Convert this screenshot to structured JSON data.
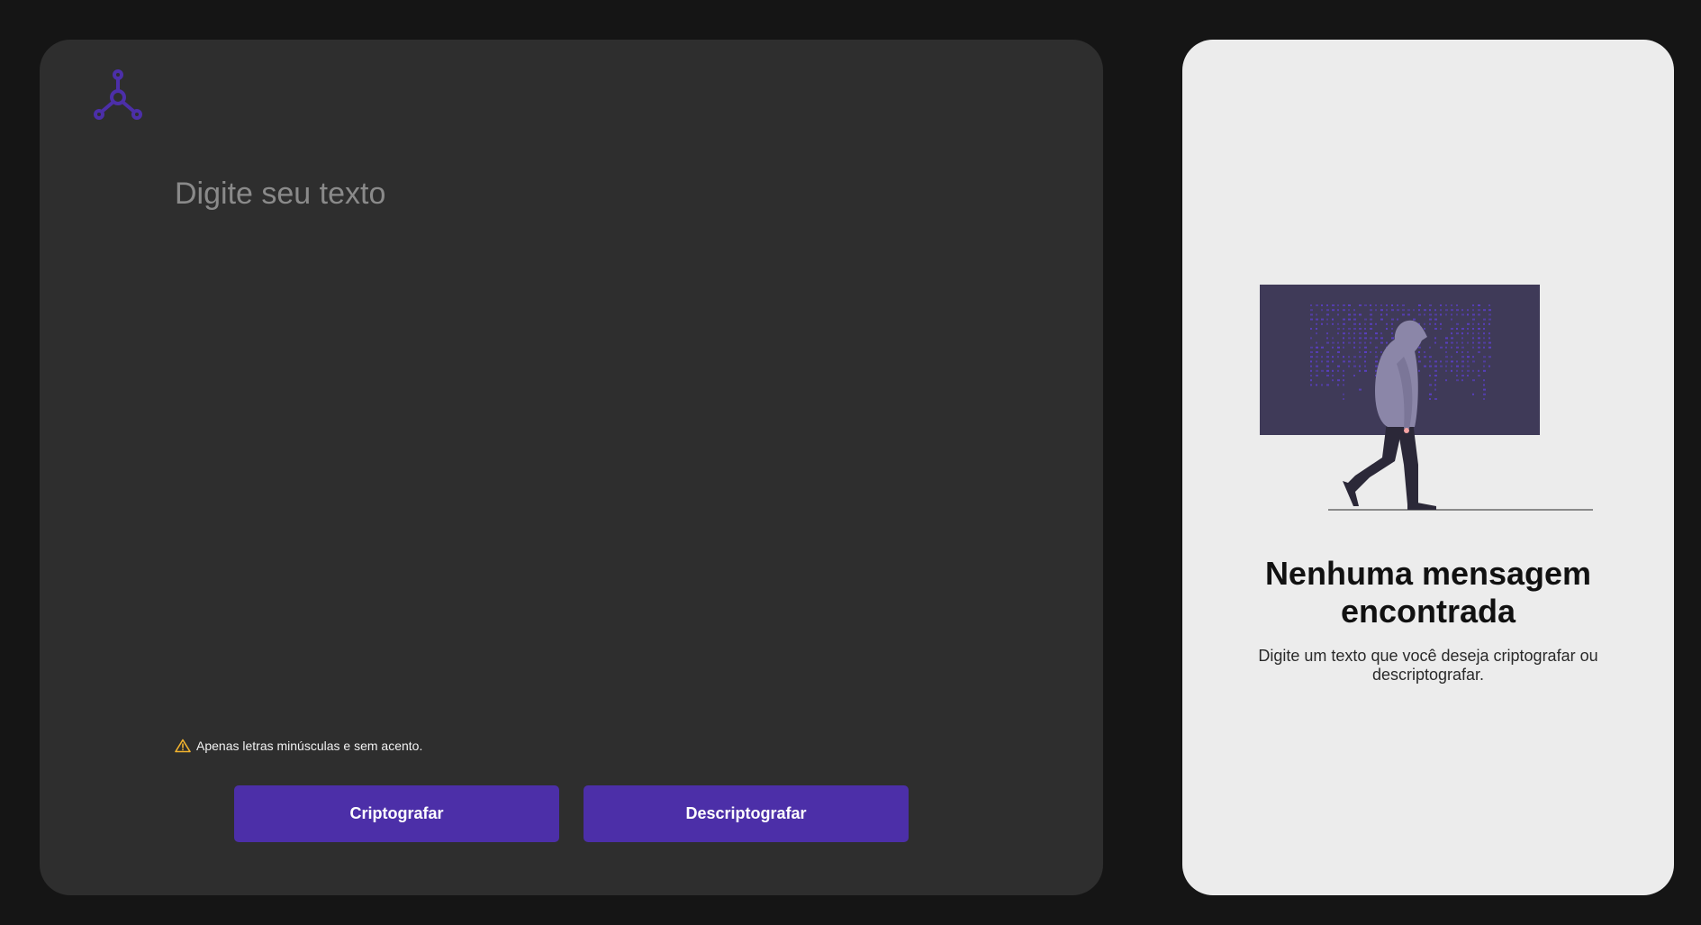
{
  "app": {
    "logo_icon": "molecule-network-icon",
    "accent_color": "#4c2fa8"
  },
  "editor": {
    "placeholder": "Digite seu texto",
    "value": ""
  },
  "warning": {
    "icon": "warning-triangle-icon",
    "text": "Apenas letras minúsculas e sem acento.",
    "icon_color": "#f2b32e"
  },
  "actions": {
    "encrypt_label": "Criptografar",
    "decrypt_label": "Descriptografar"
  },
  "output": {
    "illustration": "hooded-person-walking-illustration",
    "title": "Nenhuma mensagem encontrada",
    "text": "Digite um texto que você deseja criptografar ou descriptografar."
  }
}
